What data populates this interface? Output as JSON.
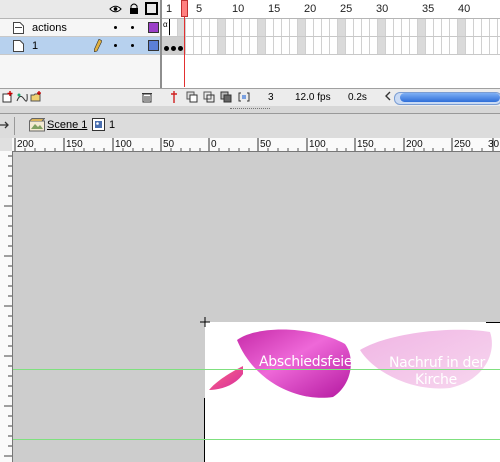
{
  "timeline": {
    "frame_numbers": [
      "1",
      "5",
      "10",
      "15",
      "20",
      "25",
      "30",
      "35",
      "40"
    ],
    "layers": [
      {
        "name": "actions",
        "color": "#9b3fc8",
        "selected": false
      },
      {
        "name": "1",
        "color": "#5b7fd6",
        "selected": true
      }
    ],
    "current_frame": "3",
    "frame_rate": "12.0 fps",
    "elapsed_time": "0.2s"
  },
  "editbar": {
    "scene_label": "Scene 1",
    "symbol_label": "1"
  },
  "ruler": {
    "labels": [
      "200",
      "150",
      "100",
      "50",
      "0",
      "50",
      "100",
      "150",
      "200",
      "250",
      "30"
    ]
  },
  "stage": {
    "petal_text_1": "Abschiedsfeier",
    "petal_text_2_line1": "Nachruf in der",
    "petal_text_2_line2": "Kirche"
  },
  "icons": [
    "eye-icon",
    "lock-icon",
    "outline-icon",
    "layer-icon",
    "pencil-icon",
    "insert-layer-icon",
    "add-motion-guide-icon",
    "insert-folder-icon",
    "trash-icon",
    "center-frame-icon",
    "onion-skin-icon",
    "onion-outline-icon",
    "edit-multiple-frames-icon",
    "onion-markers-icon",
    "scene-icon",
    "symbol-icon",
    "edit-arrow-icon",
    "crosshair-icon"
  ]
}
